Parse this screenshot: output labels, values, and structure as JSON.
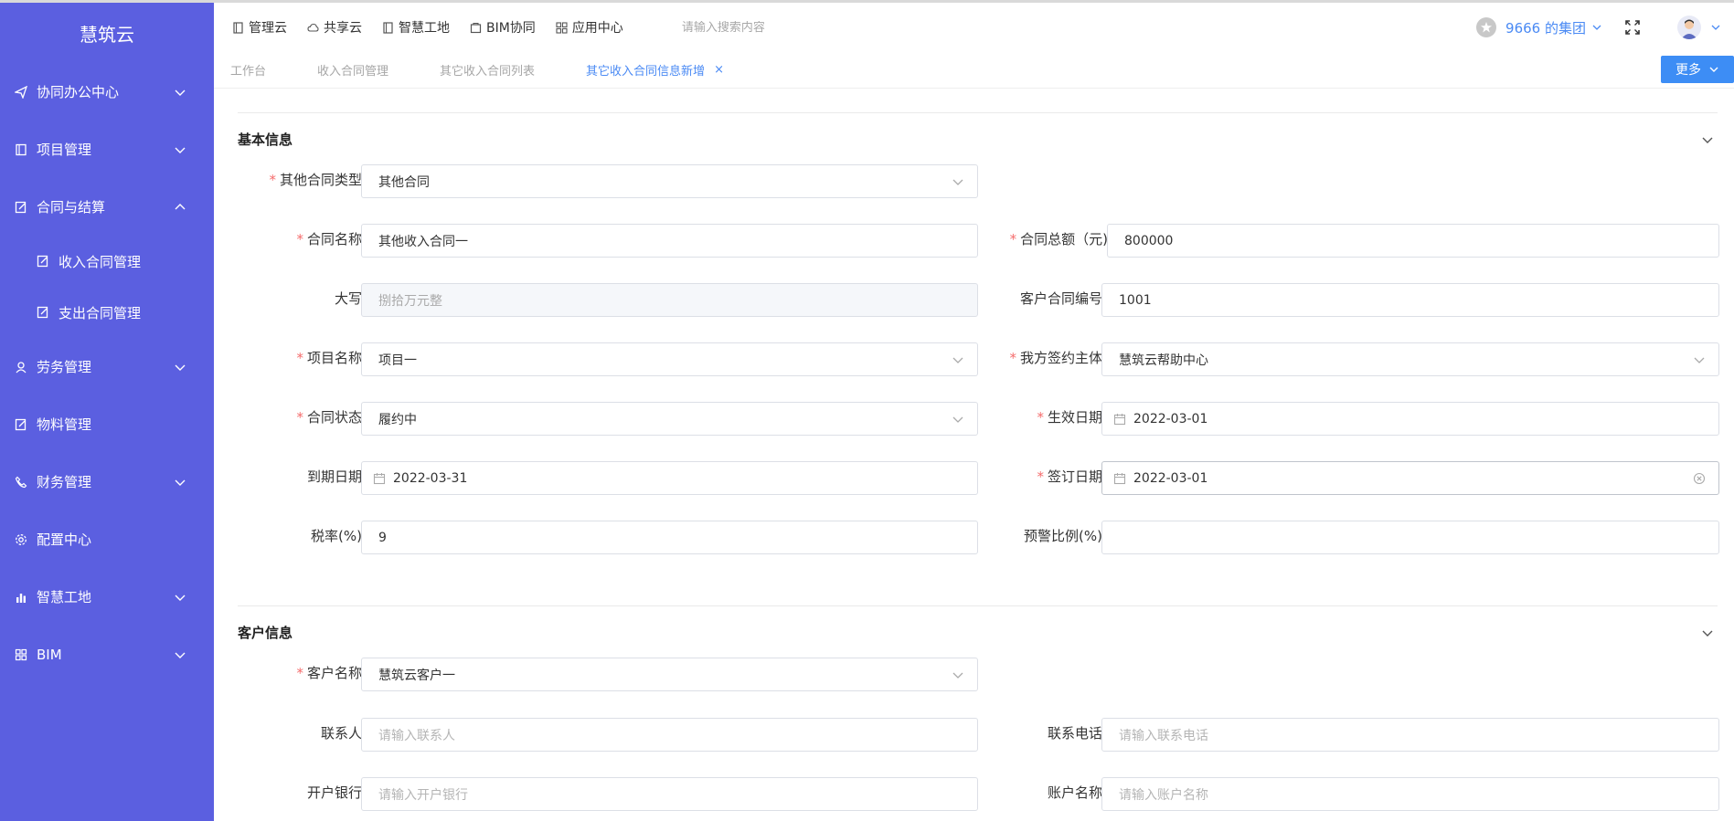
{
  "app": {
    "brand": "慧筑云"
  },
  "sidebar": {
    "items": [
      {
        "label": "协同办公中心"
      },
      {
        "label": "项目管理"
      },
      {
        "label": "合同与结算"
      },
      {
        "label": "收入合同管理"
      },
      {
        "label": "支出合同管理"
      },
      {
        "label": "劳务管理"
      },
      {
        "label": "物料管理"
      },
      {
        "label": "财务管理"
      },
      {
        "label": "配置中心"
      },
      {
        "label": "智慧工地"
      },
      {
        "label": "BIM"
      }
    ]
  },
  "topbar": {
    "nav": [
      {
        "label": "管理云"
      },
      {
        "label": "共享云"
      },
      {
        "label": "智慧工地"
      },
      {
        "label": "BIM协同"
      },
      {
        "label": "应用中心"
      }
    ],
    "search_placeholder": "请输入搜索内容",
    "org_name": "9666 的集团"
  },
  "tabs": {
    "items": [
      {
        "label": "工作台"
      },
      {
        "label": "收入合同管理"
      },
      {
        "label": "其它收入合同列表"
      },
      {
        "label": "其它收入合同信息新增"
      }
    ],
    "close_symbol": "×",
    "more_label": "更多"
  },
  "form": {
    "basic": {
      "title": "基本信息",
      "contract_type": {
        "label": "其他合同类型",
        "value": "其他合同"
      },
      "contract_name": {
        "label": "合同名称",
        "value": "其他收入合同一"
      },
      "contract_total": {
        "label": "合同总额（元)",
        "value": "800000"
      },
      "uppercase": {
        "label": "大写",
        "value": "捌拾万元整"
      },
      "customer_contract_no": {
        "label": "客户合同编号",
        "value": "1001"
      },
      "project_name": {
        "label": "项目名称",
        "value": "项目一"
      },
      "sign_party": {
        "label": "我方签约主体",
        "value": "慧筑云帮助中心"
      },
      "contract_status": {
        "label": "合同状态",
        "value": "履约中"
      },
      "effective_date": {
        "label": "生效日期",
        "value": "2022-03-01"
      },
      "expiry_date": {
        "label": "到期日期",
        "value": "2022-03-31"
      },
      "sign_date": {
        "label": "签订日期",
        "value": "2022-03-01"
      },
      "tax_rate": {
        "label": "税率(%)",
        "value": "9"
      },
      "warning_ratio": {
        "label": "预警比例(%)",
        "value": ""
      }
    },
    "customer": {
      "title": "客户信息",
      "customer_name": {
        "label": "客户名称",
        "value": "慧筑云客户一"
      },
      "contact": {
        "label": "联系人",
        "placeholder": "请输入联系人"
      },
      "phone": {
        "label": "联系电话",
        "placeholder": "请输入联系电话"
      },
      "bank": {
        "label": "开户银行",
        "placeholder": "请输入开户银行"
      },
      "account_name": {
        "label": "账户名称",
        "placeholder": "请输入账户名称"
      }
    }
  },
  "colors": {
    "sidebar_bg": "#5b5fe0",
    "accent": "#4a8af4",
    "more_button": "#3d8df5",
    "required": "#f56c6c"
  }
}
